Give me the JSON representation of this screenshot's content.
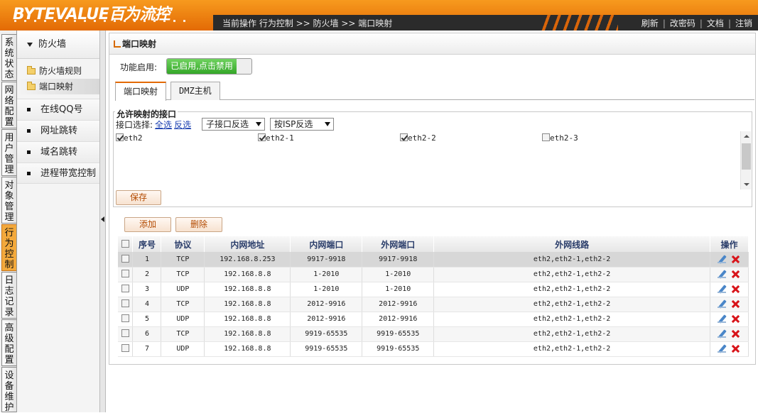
{
  "header": {
    "logo": "BYTEVALUE百为流控",
    "breadcrumb": "当前操作  行为控制 >> 防火墙 >> 端口映射",
    "links": [
      "刷新",
      "改密码",
      "文档",
      "注销"
    ]
  },
  "vtabs": [
    "系统状态",
    "网络配置",
    "用户管理",
    "对象管理",
    "行为控制",
    "日志记录",
    "高级配置",
    "设备维护"
  ],
  "leftmenu": {
    "group": "防火墙",
    "subs": [
      "防火墙规则",
      "端口映射"
    ],
    "items": [
      "在线QQ号",
      "网址跳转",
      "域名跳转",
      "进程带宽控制"
    ]
  },
  "panel": {
    "title": "端口映射",
    "feature_label": "功能启用:",
    "toggle_text": "已启用,点击禁用",
    "tabs": [
      "端口映射",
      "DMZ主机"
    ]
  },
  "fieldset": {
    "legend": "允许映射的接口",
    "select_label": "接口选择:",
    "select_all": "全选",
    "invert": "反选",
    "sub_select": "子接口反选",
    "isp_select": "按ISP反选",
    "interfaces": [
      {
        "name": "eth2",
        "checked": true
      },
      {
        "name": "eth2-1",
        "checked": true
      },
      {
        "name": "eth2-2",
        "checked": true
      },
      {
        "name": "eth2-3",
        "checked": false
      }
    ],
    "save": "保存"
  },
  "buttons": {
    "add": "添加",
    "delete": "删除"
  },
  "table": {
    "headers": [
      "序号",
      "协议",
      "内网地址",
      "内网端口",
      "外网端口",
      "外网线路",
      "操作"
    ],
    "rows": [
      [
        "1",
        "TCP",
        "192.168.8.253",
        "9917-9918",
        "9917-9918",
        "eth2,eth2-1,eth2-2"
      ],
      [
        "2",
        "TCP",
        "192.168.8.8",
        "1-2010",
        "1-2010",
        "eth2,eth2-1,eth2-2"
      ],
      [
        "3",
        "UDP",
        "192.168.8.8",
        "1-2010",
        "1-2010",
        "eth2,eth2-1,eth2-2"
      ],
      [
        "4",
        "TCP",
        "192.168.8.8",
        "2012-9916",
        "2012-9916",
        "eth2,eth2-1,eth2-2"
      ],
      [
        "5",
        "UDP",
        "192.168.8.8",
        "2012-9916",
        "2012-9916",
        "eth2,eth2-1,eth2-2"
      ],
      [
        "6",
        "TCP",
        "192.168.8.8",
        "9919-65535",
        "9919-65535",
        "eth2,eth2-1,eth2-2"
      ],
      [
        "7",
        "UDP",
        "192.168.8.8",
        "9919-65535",
        "9919-65535",
        "eth2,eth2-1,eth2-2"
      ]
    ]
  },
  "colors": {
    "brand": "#e36a05",
    "toggle_on": "#34a728",
    "link": "#1a3fb0",
    "button_text": "#b34a00"
  }
}
